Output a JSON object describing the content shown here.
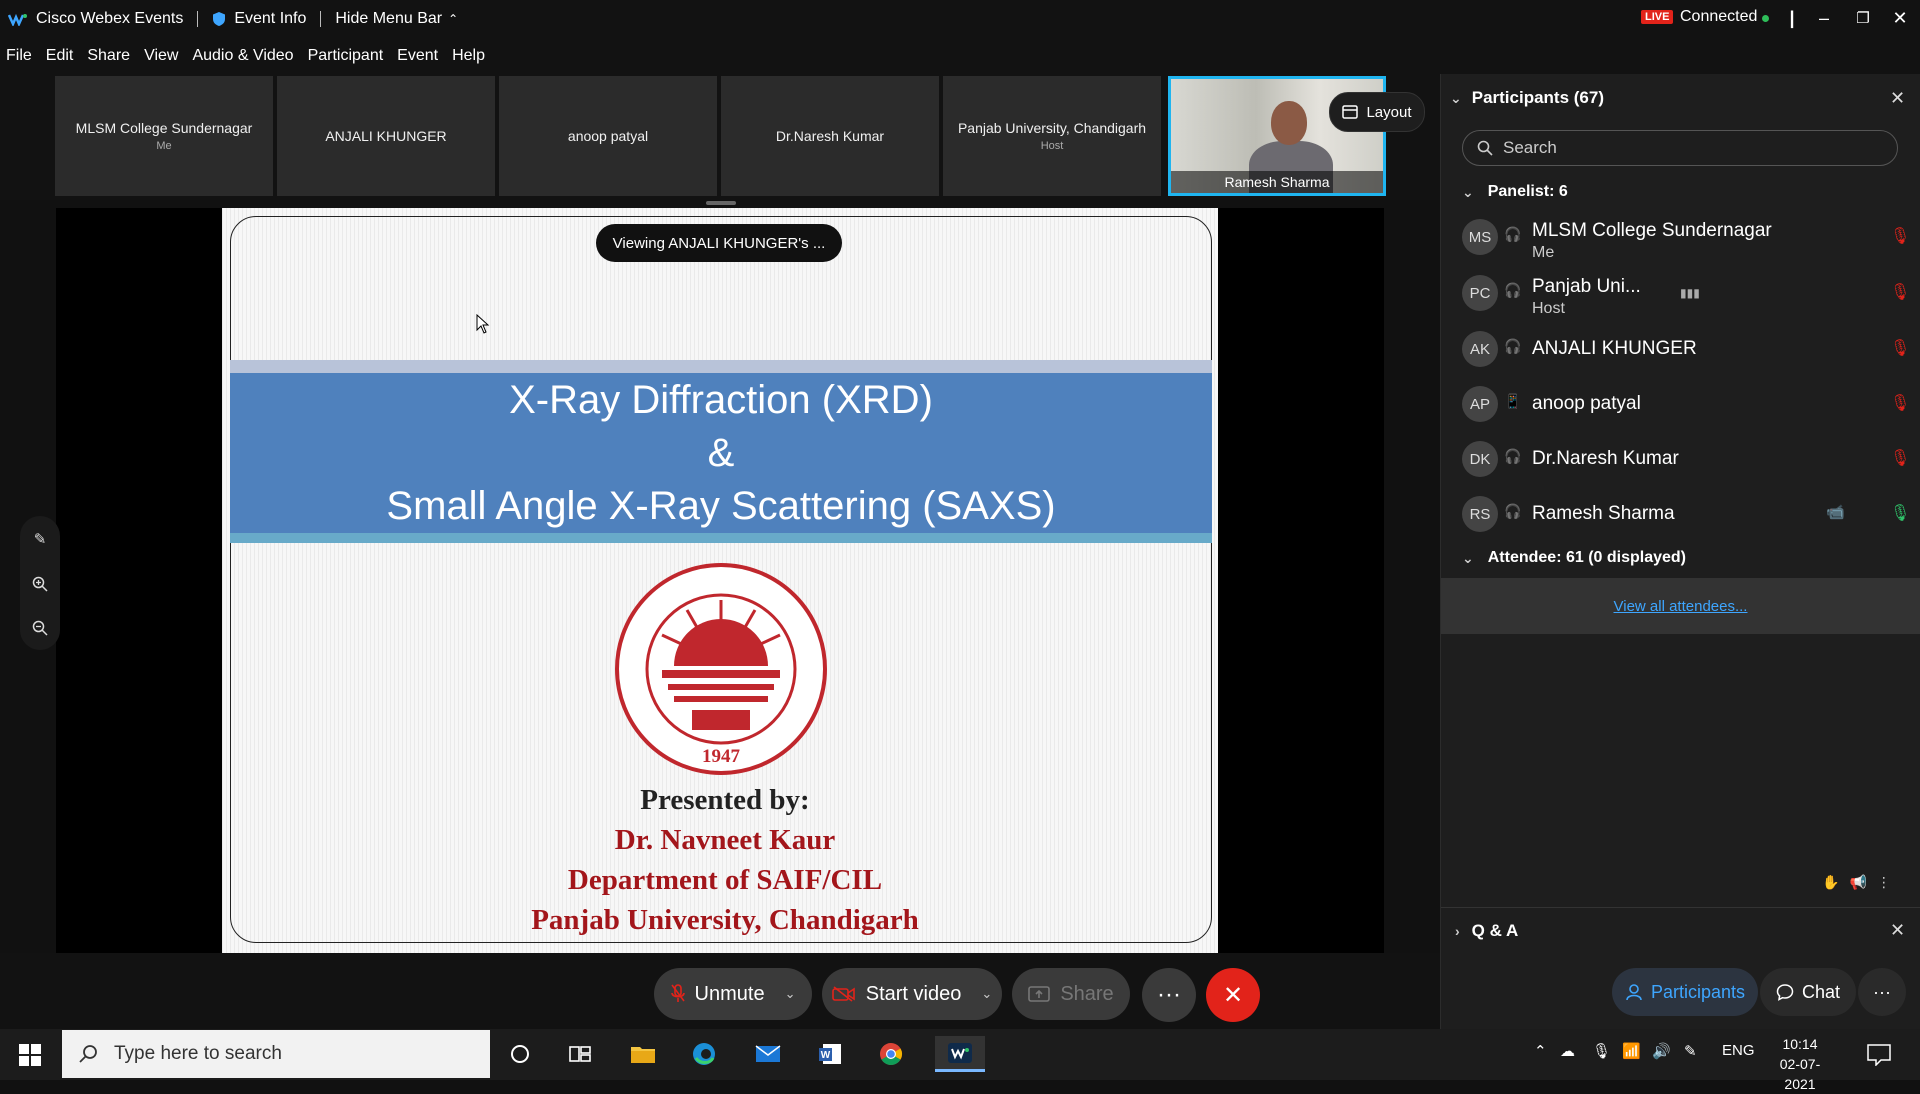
{
  "titlebar": {
    "app_name": "Cisco Webex Events",
    "event_info": "Event Info",
    "hide_menu": "Hide Menu Bar",
    "live": "LIVE",
    "status": "Connected"
  },
  "menu": [
    "File",
    "Edit",
    "Share",
    "View",
    "Audio & Video",
    "Participant",
    "Event",
    "Help"
  ],
  "tiles": [
    {
      "name": "MLSM College Sundernagar",
      "role": "Me"
    },
    {
      "name": "ANJALI KHUNGER",
      "role": ""
    },
    {
      "name": "anoop patyal",
      "role": ""
    },
    {
      "name": "Dr.Naresh Kumar",
      "role": ""
    },
    {
      "name": "Panjab University, Chandigarh",
      "role": "Host"
    }
  ],
  "active_video": {
    "name": "Ramesh Sharma"
  },
  "layout_label": "Layout",
  "viewing_label": "Viewing ANJALI KHUNGER's ...",
  "slide": {
    "title_line1": "X-Ray Diffraction (XRD)",
    "title_line2": "&",
    "title_line3": "Small Angle X-Ray Scattering (SAXS)",
    "presented_by": "Presented by:",
    "presenter": "Dr. Navneet Kaur",
    "department": "Department of SAIF/CIL",
    "university": "Panjab University, Chandigarh",
    "seal_year": "1947"
  },
  "controls": {
    "unmute": "Unmute",
    "start_video": "Start video",
    "share": "Share",
    "more": "···",
    "leave": "✕"
  },
  "panel": {
    "title": "Participants (67)",
    "search_placeholder": "Search",
    "panelist_label": "Panelist: 6",
    "panelists": [
      {
        "initials": "MS",
        "name": "MLSM College Sundernagar",
        "sub": "Me"
      },
      {
        "initials": "PC",
        "name": "Panjab Uni...",
        "sub": "Host"
      },
      {
        "initials": "AK",
        "name": "ANJALI KHUNGER",
        "sub": ""
      },
      {
        "initials": "AP",
        "name": "anoop patyal",
        "sub": ""
      },
      {
        "initials": "DK",
        "name": "Dr.Naresh Kumar",
        "sub": ""
      },
      {
        "initials": "RS",
        "name": "Ramesh Sharma",
        "sub": ""
      }
    ],
    "attendee_label": "Attendee: 61 (0 displayed)",
    "view_all": "View all attendees...",
    "qa_label": "Q & A",
    "participants_tab": "Participants",
    "chat_tab": "Chat",
    "more_tab": "···"
  },
  "taskbar": {
    "search_placeholder": "Type here to search",
    "lang": "ENG",
    "time": "10:14",
    "date": "02-07-2021"
  },
  "colors": {
    "accent_blue": "#1fb5f0",
    "live_red": "#e2231a",
    "leave_red": "#e2231a",
    "muted_mic_red": "#e2231a",
    "link_blue": "#3ea6ff",
    "slide_band": "#4f81bd"
  }
}
